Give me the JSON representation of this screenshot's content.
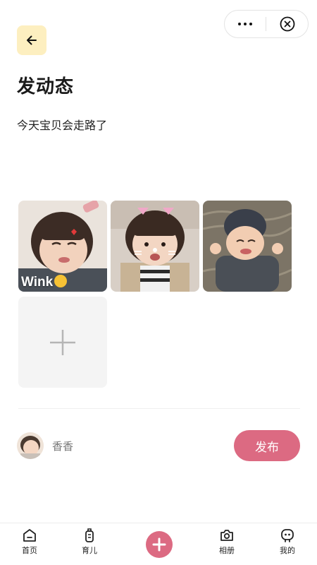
{
  "header": {
    "title": "发动态",
    "back_icon": "arrow-left-icon",
    "capsule": {
      "more_icon": "more-dots-icon",
      "close_icon": "close-circle-icon"
    }
  },
  "post": {
    "text": "今天宝贝会走路了"
  },
  "photos": [
    {
      "caption": "Wink"
    },
    {
      "caption": ""
    },
    {
      "caption": ""
    }
  ],
  "add_photo_icon": "plus-icon",
  "author": {
    "name": "香香"
  },
  "publish_button": {
    "label": "发布"
  },
  "tabbar": {
    "items": [
      {
        "label": "首页",
        "icon": "home-icon"
      },
      {
        "label": "育儿",
        "icon": "baby-bottle-icon"
      },
      {
        "label": "",
        "icon": "plus-icon"
      },
      {
        "label": "相册",
        "icon": "camera-icon"
      },
      {
        "label": "我的",
        "icon": "profile-icon"
      }
    ]
  },
  "colors": {
    "accent": "#dc6a82",
    "back_button_bg": "#fdefc0",
    "add_tile_bg": "#f4f4f4"
  }
}
